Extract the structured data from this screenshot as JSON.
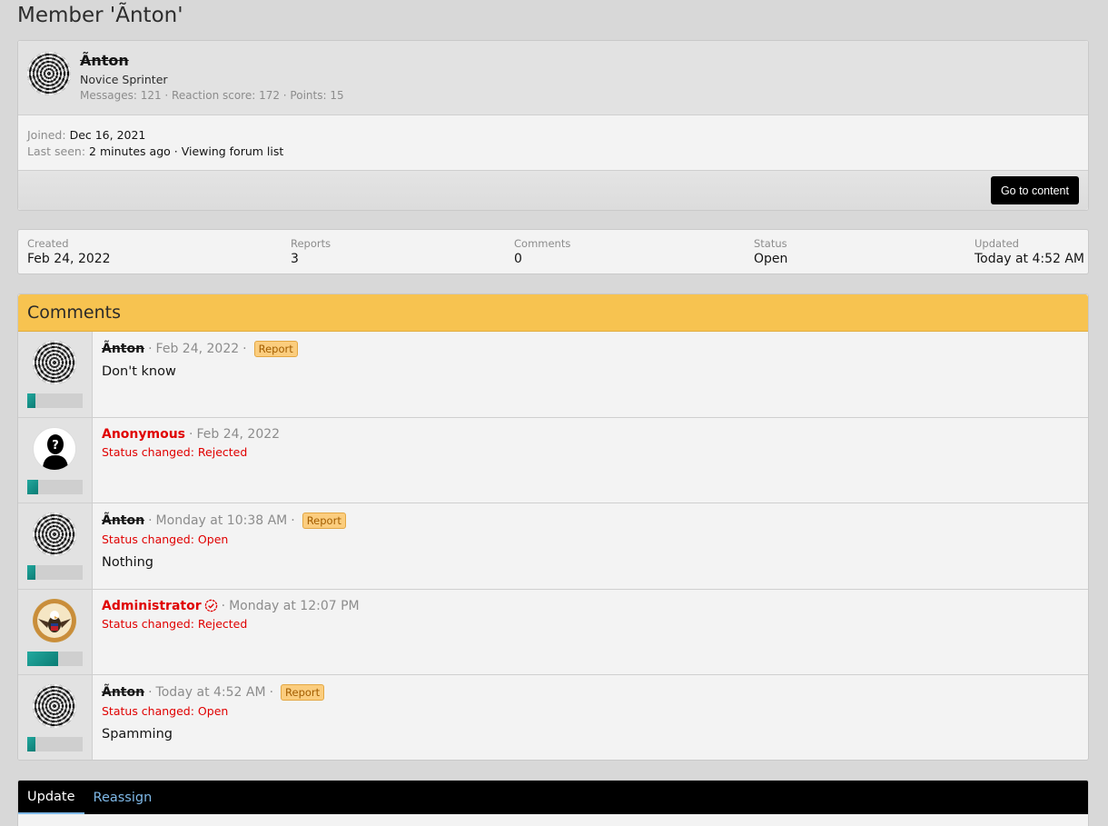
{
  "page": {
    "title": "Member 'Ãnton'"
  },
  "member": {
    "name": "Ãnton",
    "user_title": "Novice Sprinter",
    "stats": "Messages: 121 · Reaction score: 172 · Points: 15",
    "joined_label": "Joined:",
    "joined_value": "Dec 16, 2021",
    "last_seen_label": "Last seen:",
    "last_seen_value": "2 minutes ago · Viewing forum list",
    "goto_label": "Go to content"
  },
  "report_stats": [
    {
      "label": "Created",
      "value": "Feb 24, 2022"
    },
    {
      "label": "Reports",
      "value": "3"
    },
    {
      "label": "Comments",
      "value": "0"
    },
    {
      "label": "Status",
      "value": "Open"
    },
    {
      "label": "Updated",
      "value": "Today at 4:52 AM"
    }
  ],
  "comments": {
    "heading": "Comments",
    "items": [
      {
        "user": "Ãnton",
        "time": "Feb 24, 2022",
        "badge": "Report",
        "status": "",
        "body": "Don't know",
        "level": 0.15
      },
      {
        "user": "Anonymous",
        "time": "Feb 24, 2022",
        "badge": "",
        "status": "Status changed: Rejected",
        "body": "",
        "level": 0.2
      },
      {
        "user": "Ãnton",
        "time": "Monday at 10:38 AM",
        "badge": "Report",
        "status": "Status changed: Open",
        "body": "Nothing",
        "level": 0.15
      },
      {
        "user": "Administrator",
        "time": "Monday at 12:07 PM",
        "badge": "",
        "status": "Status changed: Rejected",
        "body": "",
        "level": 0.55
      },
      {
        "user": "Ãnton",
        "time": "Today at 4:52 AM",
        "badge": "Report",
        "status": "Status changed: Open",
        "body": "Spamming",
        "level": 0.15
      }
    ]
  },
  "tabs": {
    "update": "Update",
    "reassign": "Reassign"
  },
  "colors": {
    "accent_header": "#f7c350",
    "danger": "#e00000",
    "badge": "#fbcd7e",
    "tab_link": "#7fb9e8"
  },
  "icons": {
    "verified": "verified-badge-icon"
  }
}
